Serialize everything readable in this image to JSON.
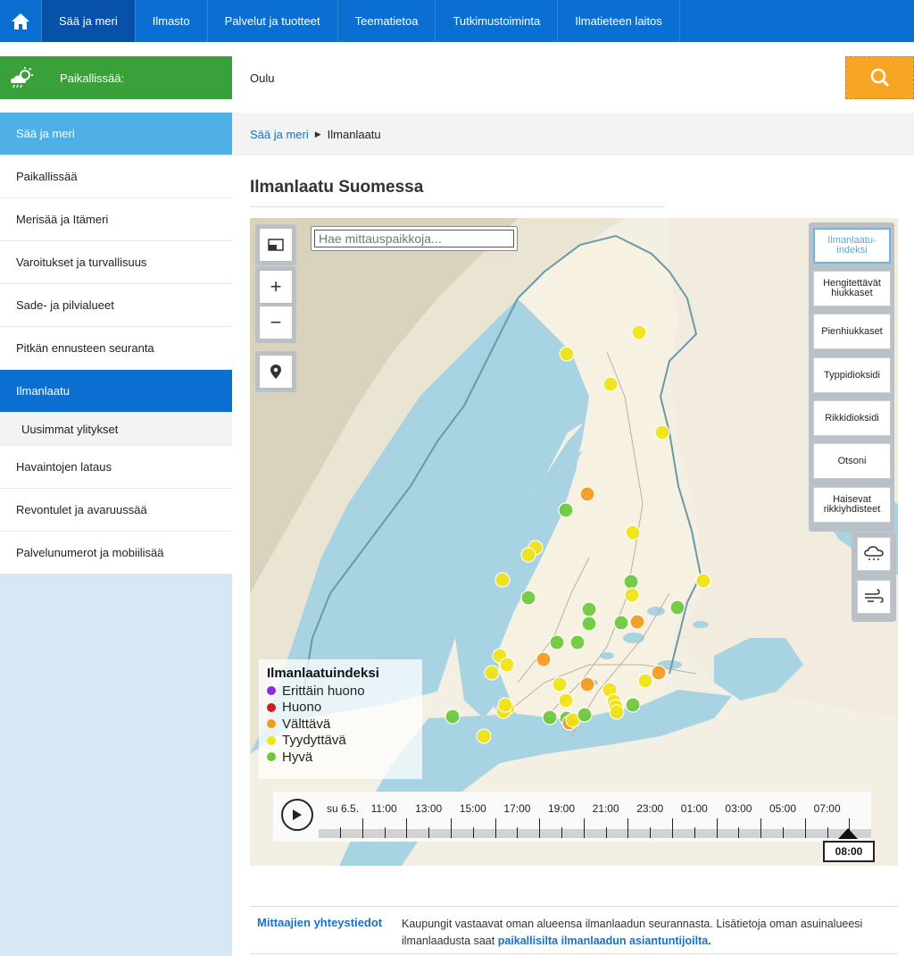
{
  "topnav": {
    "items": [
      "Sää ja meri",
      "Ilmasto",
      "Palvelut ja tuotteet",
      "Teematietoa",
      "Tutkimustoiminta",
      "Ilmatieteen laitos"
    ]
  },
  "local": {
    "label": "Paikallissää:",
    "value": "Oulu"
  },
  "sidebar": {
    "items": [
      "Sää ja meri",
      "Paikallissää",
      "Merisää ja Itämeri",
      "Varoitukset ja turvallisuus",
      "Sade- ja pilvialueet",
      "Pitkän ennusteen seuranta",
      "Ilmanlaatu",
      "Uusimmat ylitykset",
      "Havaintojen lataus",
      "Revontulet ja avaruussää",
      "Palvelunumerot ja mobiilisää"
    ]
  },
  "breadcrumb": {
    "parent": "Sää ja meri",
    "current": "Ilmanlaatu"
  },
  "page_title": "Ilmanlaatu Suomessa",
  "map": {
    "search_placeholder": "Hae mittauspaikkoja...",
    "layers": [
      "Ilmanlaatu-indeksi",
      "Hengitettävät hiukkaset",
      "Pienhiukkaset",
      "Typpidioksidi",
      "Rikkidioksidi",
      "Otsoni",
      "Haisevat rikkiyhdisteet"
    ],
    "legend": {
      "title": "Ilmanlaatuindeksi",
      "items": [
        {
          "label": "Erittäin huono",
          "color": "#8a2be2"
        },
        {
          "label": "Huono",
          "color": "#cc1f1f"
        },
        {
          "label": "Välttävä",
          "color": "#f59a1b"
        },
        {
          "label": "Tyydyttävä",
          "color": "#f2e312"
        },
        {
          "label": "Hyvä",
          "color": "#6cc83a"
        }
      ]
    },
    "timeline": {
      "labels": [
        "su 6.5.",
        "11:00",
        "13:00",
        "15:00",
        "17:00",
        "19:00",
        "21:00",
        "23:00",
        "01:00",
        "03:00",
        "05:00",
        "07:00"
      ],
      "current": "08:00"
    }
  },
  "info": {
    "key": "Mittaajien yhteystiedot",
    "text": "Kaupungit vastaavat oman alueensa ilmanlaadun seurannasta. Lisätietoja oman asuinalueesi ilmanlaadusta saat",
    "link": "paikallisilta ilmanlaadun asiantuntijoilta."
  }
}
